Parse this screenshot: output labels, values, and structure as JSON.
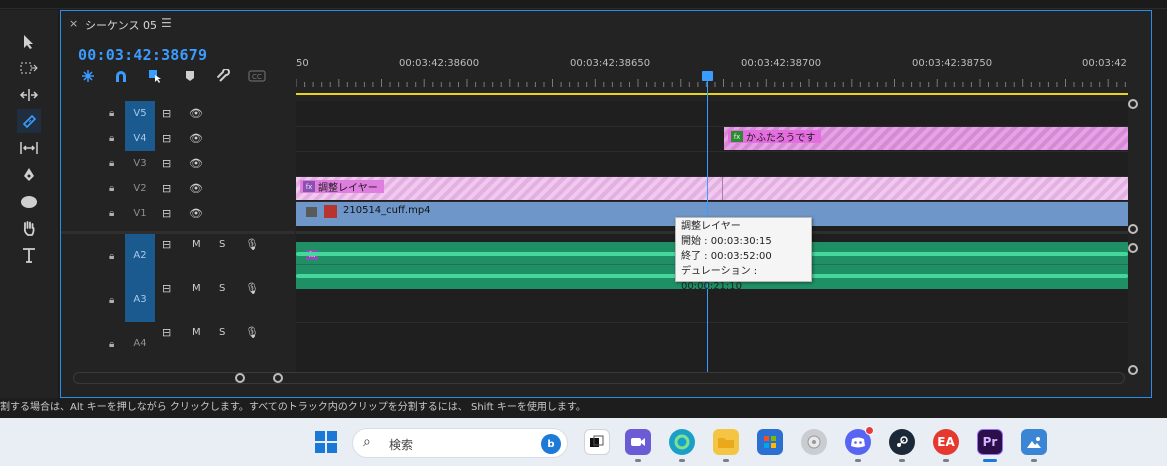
{
  "panel": {
    "close_glyph": "×",
    "tab_title": "シーケンス 05",
    "tab_menu_glyph": "☰",
    "timecode": "00:03:42:38679"
  },
  "ruler": {
    "labels": [
      "50",
      "00:03:42:38600",
      "00:03:42:38650",
      "00:03:42:38700",
      "00:03:42:38750",
      "00:03:42"
    ]
  },
  "tracks": {
    "video": [
      {
        "label": "V5",
        "targeted": true
      },
      {
        "label": "V4",
        "targeted": true
      },
      {
        "label": "V3",
        "targeted": false
      },
      {
        "label": "V2",
        "targeted": false
      },
      {
        "label": "V1",
        "targeted": false
      }
    ],
    "audio": [
      {
        "label": "A2",
        "targeted": true,
        "m": "M",
        "s": "S"
      },
      {
        "label": "A3",
        "targeted": true,
        "m": "M",
        "s": "S"
      },
      {
        "label": "A4",
        "targeted": false,
        "m": "M",
        "s": "S"
      }
    ]
  },
  "clips": {
    "v4_title": "かふたろうです",
    "v2_title": "調整レイヤー",
    "v1_title": "210514_cuff.mp4",
    "fx_glyph": "fx"
  },
  "tooltip": {
    "title": "調整レイヤー",
    "start": "開始 : 00:03:30:15",
    "end": "終了 : 00:03:52:00",
    "duration": "デュレーション : 00:00:21:10"
  },
  "statusbar": {
    "text": "割する場合は、Alt キーを押しながら クリックします。すべてのトラック内のクリップを分割するには、 Shift キーを使用します。"
  },
  "taskbar": {
    "search_placeholder": "検索",
    "search_badge": "b",
    "apps": [
      "file-explorer-light",
      "meet",
      "edge",
      "file-explorer",
      "store",
      "media",
      "discord",
      "steam",
      "ea",
      "premiere-pro",
      "photos"
    ],
    "premiere_label": "Pr",
    "ea_label": "EA",
    "accent_color": "#1e7ad7"
  },
  "colors": {
    "accent_blue": "#3b9cff",
    "v2_clip": "#f1c8f0",
    "v4_clip": "#e7a1e6",
    "v1_clip": "#6e96c9",
    "audio_clip": "#1f8f66",
    "work_area": "#e8d31d"
  }
}
